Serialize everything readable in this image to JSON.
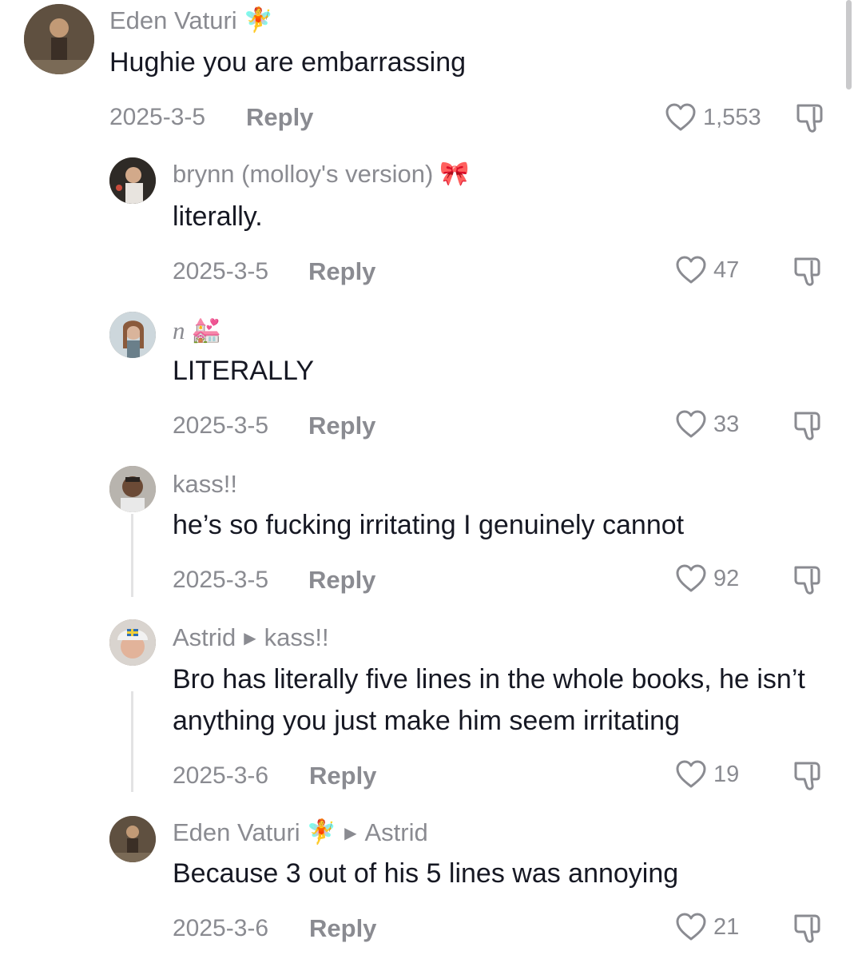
{
  "comments": [
    {
      "username": "Eden Vaturi",
      "emoji": "🧚",
      "text": "Hughie you are embarrassing",
      "date": "2025-3-5",
      "reply": "Reply",
      "likes": "1,553"
    },
    {
      "username": "brynn (molloy's version)",
      "emoji": "🎀",
      "text": "literally.",
      "date": "2025-3-5",
      "reply": "Reply",
      "likes": "47"
    },
    {
      "username": "n",
      "emoji": "💒",
      "text": "LITERALLY",
      "date": "2025-3-5",
      "reply": "Reply",
      "likes": "33"
    },
    {
      "username": "kass!!",
      "text": "he’s so fucking irritating I genuinely cannot",
      "date": "2025-3-5",
      "reply": "Reply",
      "likes": "92"
    },
    {
      "username": "Astrid",
      "replying_to": "kass!!",
      "text": "Bro has literally five lines in the whole books, he isn’t anything you just make him seem irritating",
      "date": "2025-3-6",
      "reply": "Reply",
      "likes": "19"
    },
    {
      "username": "Eden Vaturi",
      "emoji": "🧚",
      "replying_to": "Astrid",
      "text": "Because 3 out of his 5 lines was annoying",
      "date": "2025-3-6",
      "reply": "Reply",
      "likes": "21"
    }
  ],
  "icons": {
    "like": "heart-outline-icon",
    "dislike": "thumbs-down-icon",
    "reply_arrow": "triangle-right-icon"
  },
  "colors": {
    "text": "#161823",
    "muted": "#8a8b91"
  }
}
